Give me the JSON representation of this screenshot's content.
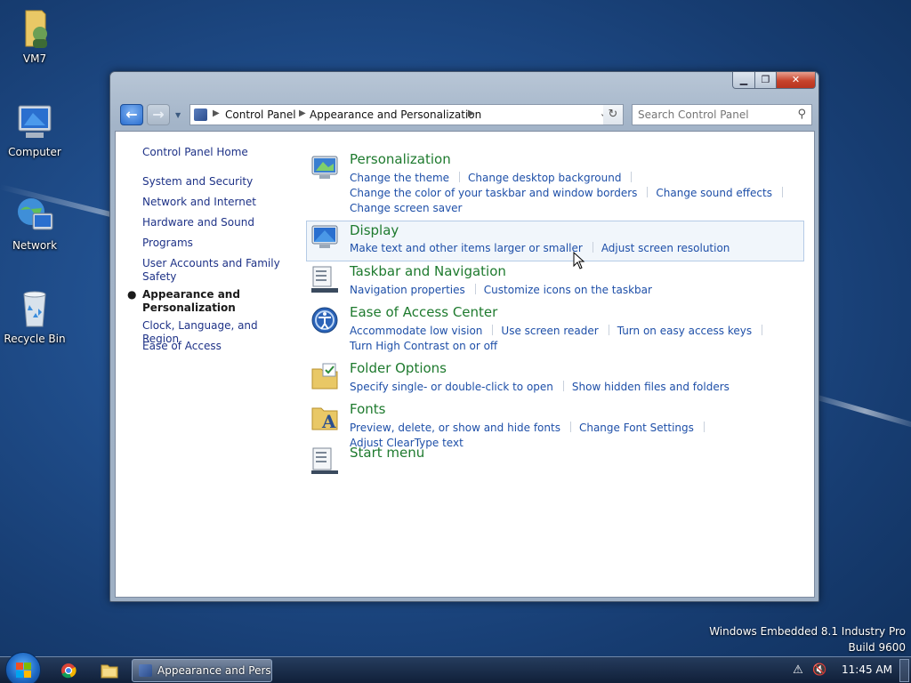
{
  "desktop": {
    "icons": [
      {
        "label": "VM7",
        "icon": "user-folder-icon"
      },
      {
        "label": "Computer",
        "icon": "computer-icon"
      },
      {
        "label": "Network",
        "icon": "network-icon"
      },
      {
        "label": "Recycle Bin",
        "icon": "recycle-bin-icon"
      }
    ],
    "watermark": {
      "line1": "Windows Embedded 8.1 Industry Pro",
      "line2": "Build 9600"
    }
  },
  "window": {
    "controls": {
      "minimize": "▁",
      "maximize": "❐",
      "close": "✕"
    },
    "address": {
      "crumbs": [
        "Control Panel",
        "Appearance and Personalization"
      ]
    },
    "search": {
      "placeholder": "Search Control Panel"
    },
    "leftnav": {
      "items": [
        {
          "label": "Control Panel Home"
        },
        {
          "label": "System and Security"
        },
        {
          "label": "Network and Internet"
        },
        {
          "label": "Hardware and Sound"
        },
        {
          "label": "Programs"
        },
        {
          "label": "User Accounts and Family Safety"
        },
        {
          "label": "Appearance and Personalization",
          "current": true
        },
        {
          "label": "Clock, Language, and Region"
        },
        {
          "label": "Ease of Access"
        }
      ]
    },
    "categories": [
      {
        "title": "Personalization",
        "icon": "personalization-icon",
        "links": [
          "Change the theme",
          "Change desktop background",
          "Change the color of your taskbar and window borders",
          "Change sound effects",
          "Change screen saver"
        ]
      },
      {
        "title": "Display",
        "icon": "display-icon",
        "links": [
          "Make text and other items larger or smaller",
          "Adjust screen resolution"
        ]
      },
      {
        "title": "Taskbar and Navigation",
        "icon": "taskbar-icon",
        "links": [
          "Navigation properties",
          "Customize icons on the taskbar"
        ]
      },
      {
        "title": "Ease of Access Center",
        "icon": "ease-of-access-icon",
        "links": [
          "Accommodate low vision",
          "Use screen reader",
          "Turn on easy access keys",
          "Turn High Contrast on or off"
        ]
      },
      {
        "title": "Folder Options",
        "icon": "folder-options-icon",
        "links": [
          "Specify single- or double-click to open",
          "Show hidden files and folders"
        ]
      },
      {
        "title": "Fonts",
        "icon": "fonts-icon",
        "links": [
          "Preview, delete, or show and hide fonts",
          "Change Font Settings",
          "Adjust ClearType text"
        ]
      },
      {
        "title": "Start menu",
        "icon": "start-menu-icon",
        "links": []
      }
    ]
  },
  "taskbar": {
    "task_label": "Appearance and Pers...",
    "clock": "11:45 AM"
  }
}
